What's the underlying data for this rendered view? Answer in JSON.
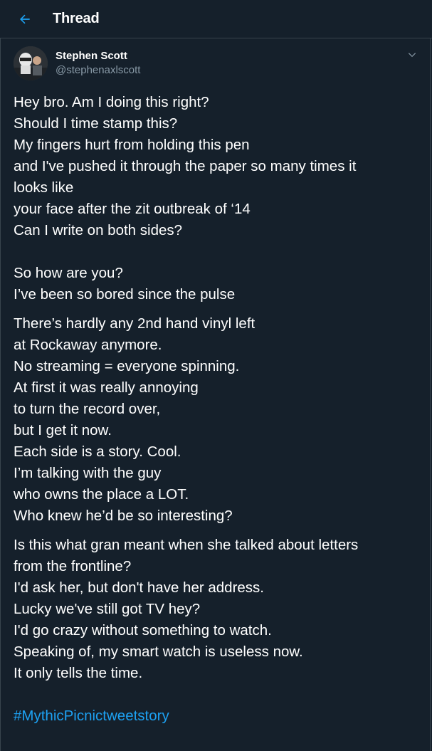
{
  "header": {
    "title": "Thread",
    "accent": "#1da1f2"
  },
  "author": {
    "name": "Stephen Scott",
    "handle": "@stephenaxlscott"
  },
  "tweet": {
    "lines": [
      "Hey bro. Am I doing this right?",
      "Should I time stamp this?",
      "My fingers hurt from holding this pen",
      "and I've pushed it through the paper so many times it",
      "looks like",
      "your face after the zit outbreak of ‘14",
      "Can I write on both sides?",
      "So how are you?",
      "I’ve been so bored since the pulse",
      "There’s hardly any 2nd hand vinyl left",
      "at Rockaway anymore.",
      "No streaming = everyone spinning.",
      "At first it was really annoying",
      "to turn the record over,",
      "but I get it now.",
      "Each side is a story. Cool.",
      "I’m talking with the guy",
      "who owns the place a LOT.",
      "Who knew he’d be so interesting?",
      "Is this what gran meant when she talked about letters",
      "from the frontline?",
      "I'd ask her, but don't have her address.",
      "Lucky we've still got TV hey?",
      "I'd go crazy without something to watch.",
      "Speaking of, my smart watch is useless now.",
      "It only tells the time."
    ],
    "hashtag": "#MythicPicnictweetstory"
  }
}
